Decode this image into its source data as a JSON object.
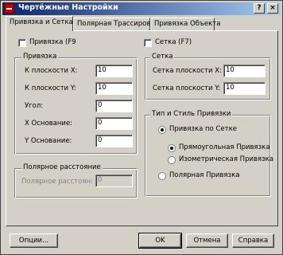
{
  "window": {
    "title": "Чертёжные Настройки",
    "help_btn": "?",
    "close_btn": "×"
  },
  "tabs": [
    {
      "label": "Привязка и Сетка",
      "active": true
    },
    {
      "label": "Полярная Трассировка",
      "active": false
    },
    {
      "label": "Привязка Объекта",
      "active": false
    }
  ],
  "snap_on": {
    "label": "Привязка (F9",
    "checked": false
  },
  "grid_on": {
    "label": "Сетка (F7)",
    "checked": false
  },
  "snap_group": {
    "title": "Привязка",
    "x_label": "К плоскости X:",
    "x_value": "10",
    "y_label": "К плоскости Y:",
    "y_value": "10",
    "angle_label": "Угол:",
    "angle_value": "0",
    "xbase_label": "X Основание:",
    "xbase_value": "0",
    "ybase_label": "Y Основание:",
    "ybase_value": "0"
  },
  "grid_group": {
    "title": "Сетка",
    "x_label": "Сетка плоскости X:",
    "x_value": "10",
    "y_label": "Сетка плоскости Y:",
    "y_value": "10"
  },
  "polar_group": {
    "title": "Полярное расстояние",
    "label": "Полярное расстоян:",
    "value": "0"
  },
  "type_group": {
    "title": "Тип и Стиль Привязки",
    "grid_snap": {
      "label": "Привязка по Сетке",
      "selected": true
    },
    "rect_snap": {
      "label": "Прямоугольная Привязка",
      "selected": true
    },
    "iso_snap": {
      "label": "Изометрическая Привязка",
      "selected": false
    },
    "polar_snap": {
      "label": "Полярная Привязка",
      "selected": false
    }
  },
  "buttons": {
    "options": "Опции...",
    "ok": "OK",
    "cancel": "Отмена",
    "help": "Справка"
  }
}
